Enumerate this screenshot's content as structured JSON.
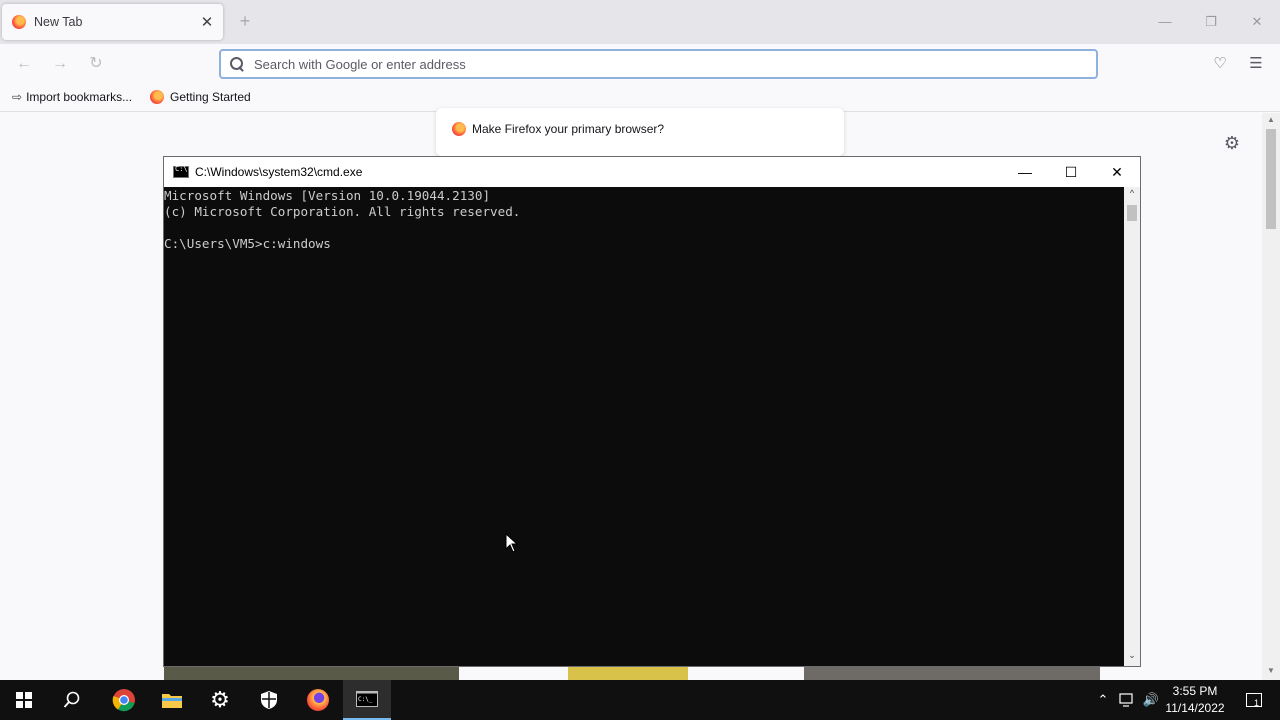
{
  "browser": {
    "tab_title": "New Tab",
    "tab_close": "✕",
    "new_tab": "+",
    "window_controls": {
      "minimize": "—",
      "restore": "❐",
      "close": "✕"
    },
    "url_placeholder": "Search with Google or enter address",
    "bookmarks": [
      {
        "label": "Import bookmarks...",
        "icon": "import-icon"
      },
      {
        "label": "Getting Started",
        "icon": "firefox-icon"
      }
    ],
    "promo_text": "Make Firefox your primary browser?"
  },
  "cmd": {
    "title": "C:\\Windows\\system32\\cmd.exe",
    "lines": [
      "Microsoft Windows [Version 10.0.19044.2130]",
      "(c) Microsoft Corporation. All rights reserved.",
      "",
      "C:\\Users\\VM5>c:windows"
    ],
    "controls": {
      "minimize": "—",
      "maximize": "☐",
      "close": "✕"
    }
  },
  "taskbar": {
    "apps": [
      "start-icon",
      "search-icon",
      "chrome-icon",
      "file-explorer-icon",
      "settings-icon",
      "windows-security-icon",
      "firefox-icon",
      "cmd-icon"
    ],
    "time": "3:55 PM",
    "date": "11/14/2022",
    "notification_count": "1"
  },
  "colors": {
    "taskbar": "#101010",
    "cmd_bg": "#0c0c0c",
    "cmd_text": "#cccccc",
    "url_focus": "#8fb1e0"
  }
}
